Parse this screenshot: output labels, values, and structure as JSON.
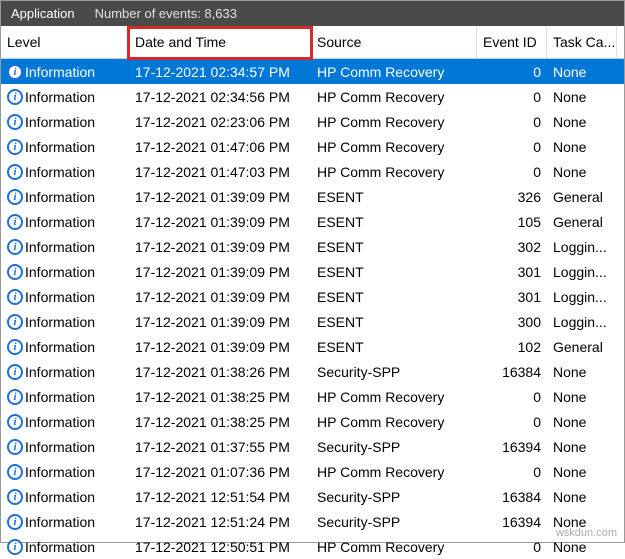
{
  "titlebar": {
    "app_name": "Application",
    "count_label": "Number of events: 8,633"
  },
  "columns": {
    "level": "Level",
    "date": "Date and Time",
    "source": "Source",
    "event_id": "Event ID",
    "task": "Task Ca..."
  },
  "icon_glyph": "i",
  "rows": [
    {
      "level": "Information",
      "date": "17-12-2021 02:34:57 PM",
      "source": "HP Comm Recovery",
      "event_id": "0",
      "task": "None",
      "selected": true
    },
    {
      "level": "Information",
      "date": "17-12-2021 02:34:56 PM",
      "source": "HP Comm Recovery",
      "event_id": "0",
      "task": "None"
    },
    {
      "level": "Information",
      "date": "17-12-2021 02:23:06 PM",
      "source": "HP Comm Recovery",
      "event_id": "0",
      "task": "None"
    },
    {
      "level": "Information",
      "date": "17-12-2021 01:47:06 PM",
      "source": "HP Comm Recovery",
      "event_id": "0",
      "task": "None"
    },
    {
      "level": "Information",
      "date": "17-12-2021 01:47:03 PM",
      "source": "HP Comm Recovery",
      "event_id": "0",
      "task": "None"
    },
    {
      "level": "Information",
      "date": "17-12-2021 01:39:09 PM",
      "source": "ESENT",
      "event_id": "326",
      "task": "General"
    },
    {
      "level": "Information",
      "date": "17-12-2021 01:39:09 PM",
      "source": "ESENT",
      "event_id": "105",
      "task": "General"
    },
    {
      "level": "Information",
      "date": "17-12-2021 01:39:09 PM",
      "source": "ESENT",
      "event_id": "302",
      "task": "Loggin..."
    },
    {
      "level": "Information",
      "date": "17-12-2021 01:39:09 PM",
      "source": "ESENT",
      "event_id": "301",
      "task": "Loggin..."
    },
    {
      "level": "Information",
      "date": "17-12-2021 01:39:09 PM",
      "source": "ESENT",
      "event_id": "301",
      "task": "Loggin..."
    },
    {
      "level": "Information",
      "date": "17-12-2021 01:39:09 PM",
      "source": "ESENT",
      "event_id": "300",
      "task": "Loggin..."
    },
    {
      "level": "Information",
      "date": "17-12-2021 01:39:09 PM",
      "source": "ESENT",
      "event_id": "102",
      "task": "General"
    },
    {
      "level": "Information",
      "date": "17-12-2021 01:38:26 PM",
      "source": "Security-SPP",
      "event_id": "16384",
      "task": "None"
    },
    {
      "level": "Information",
      "date": "17-12-2021 01:38:25 PM",
      "source": "HP Comm Recovery",
      "event_id": "0",
      "task": "None"
    },
    {
      "level": "Information",
      "date": "17-12-2021 01:38:25 PM",
      "source": "HP Comm Recovery",
      "event_id": "0",
      "task": "None"
    },
    {
      "level": "Information",
      "date": "17-12-2021 01:37:55 PM",
      "source": "Security-SPP",
      "event_id": "16394",
      "task": "None"
    },
    {
      "level": "Information",
      "date": "17-12-2021 01:07:36 PM",
      "source": "HP Comm Recovery",
      "event_id": "0",
      "task": "None"
    },
    {
      "level": "Information",
      "date": "17-12-2021 12:51:54 PM",
      "source": "Security-SPP",
      "event_id": "16384",
      "task": "None"
    },
    {
      "level": "Information",
      "date": "17-12-2021 12:51:24 PM",
      "source": "Security-SPP",
      "event_id": "16394",
      "task": "None"
    },
    {
      "level": "Information",
      "date": "17-12-2021 12:50:51 PM",
      "source": "HP Comm Recovery",
      "event_id": "0",
      "task": "None"
    }
  ],
  "watermark": "wskdun.com"
}
